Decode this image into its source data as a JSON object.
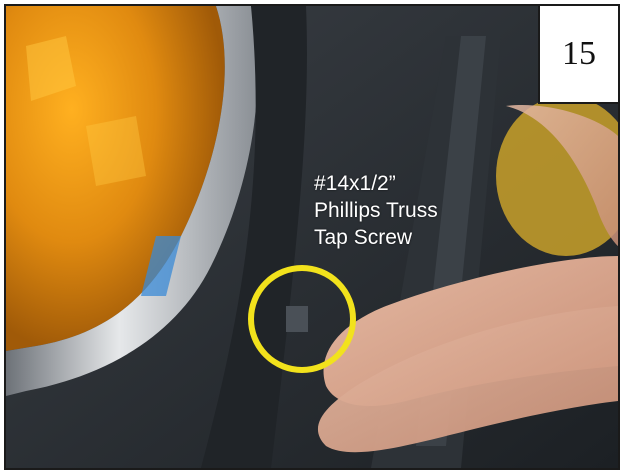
{
  "step": {
    "number": "15"
  },
  "callout": {
    "lines": [
      "#14x1/2”",
      "Phillips Truss",
      "Tap Screw"
    ]
  },
  "colors": {
    "highlight_ring": "#f2e21c",
    "frame_border": "#1a1a1a",
    "callout_text": "#ffffff"
  }
}
